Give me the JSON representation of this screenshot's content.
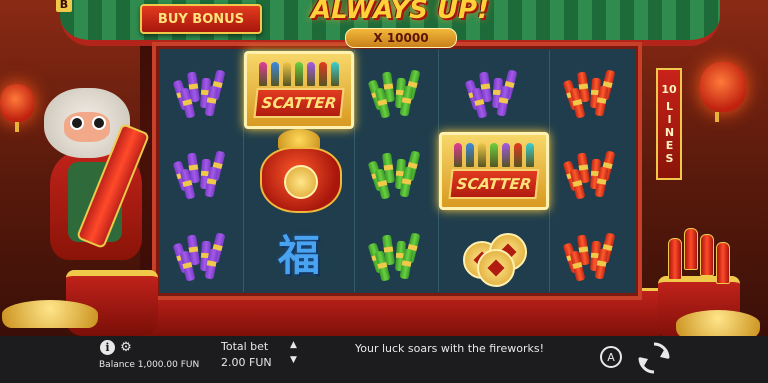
{
  "header": {
    "buy_bonus_label": "BUY BONUS",
    "b_badge": "B",
    "title": "ALWAYS UP!",
    "multiplier": "X 10000",
    "lines_banner": [
      "10",
      "LINES"
    ]
  },
  "reels": {
    "columns": [
      [
        "firecracker-purple",
        "firecracker-purple",
        "firecracker-purple"
      ],
      [
        "scatter",
        "lucky-bag",
        "fu-character"
      ],
      [
        "firecracker-green",
        "firecracker-green",
        "firecracker-green"
      ],
      [
        "firecracker-purple",
        "scatter",
        "gold-coins"
      ],
      [
        "firecracker-red",
        "firecracker-red",
        "firecracker-red"
      ]
    ],
    "scatter_label": "SCATTER",
    "fu_text": "福"
  },
  "footer": {
    "info_label": "i",
    "settings_icon": "gear-icon",
    "balance": "Balance 1,000.00 FUN",
    "total_bet_label": "Total bet",
    "total_bet_value": "2.00 FUN",
    "message": "Your luck soars with the fireworks!",
    "autoplay_label": "A"
  },
  "colors": {
    "reel_background": "#1f3d4c",
    "frame_red": "#c9402a",
    "gold": "#f0c84a",
    "bottom_bar": "#1c1c1e"
  }
}
